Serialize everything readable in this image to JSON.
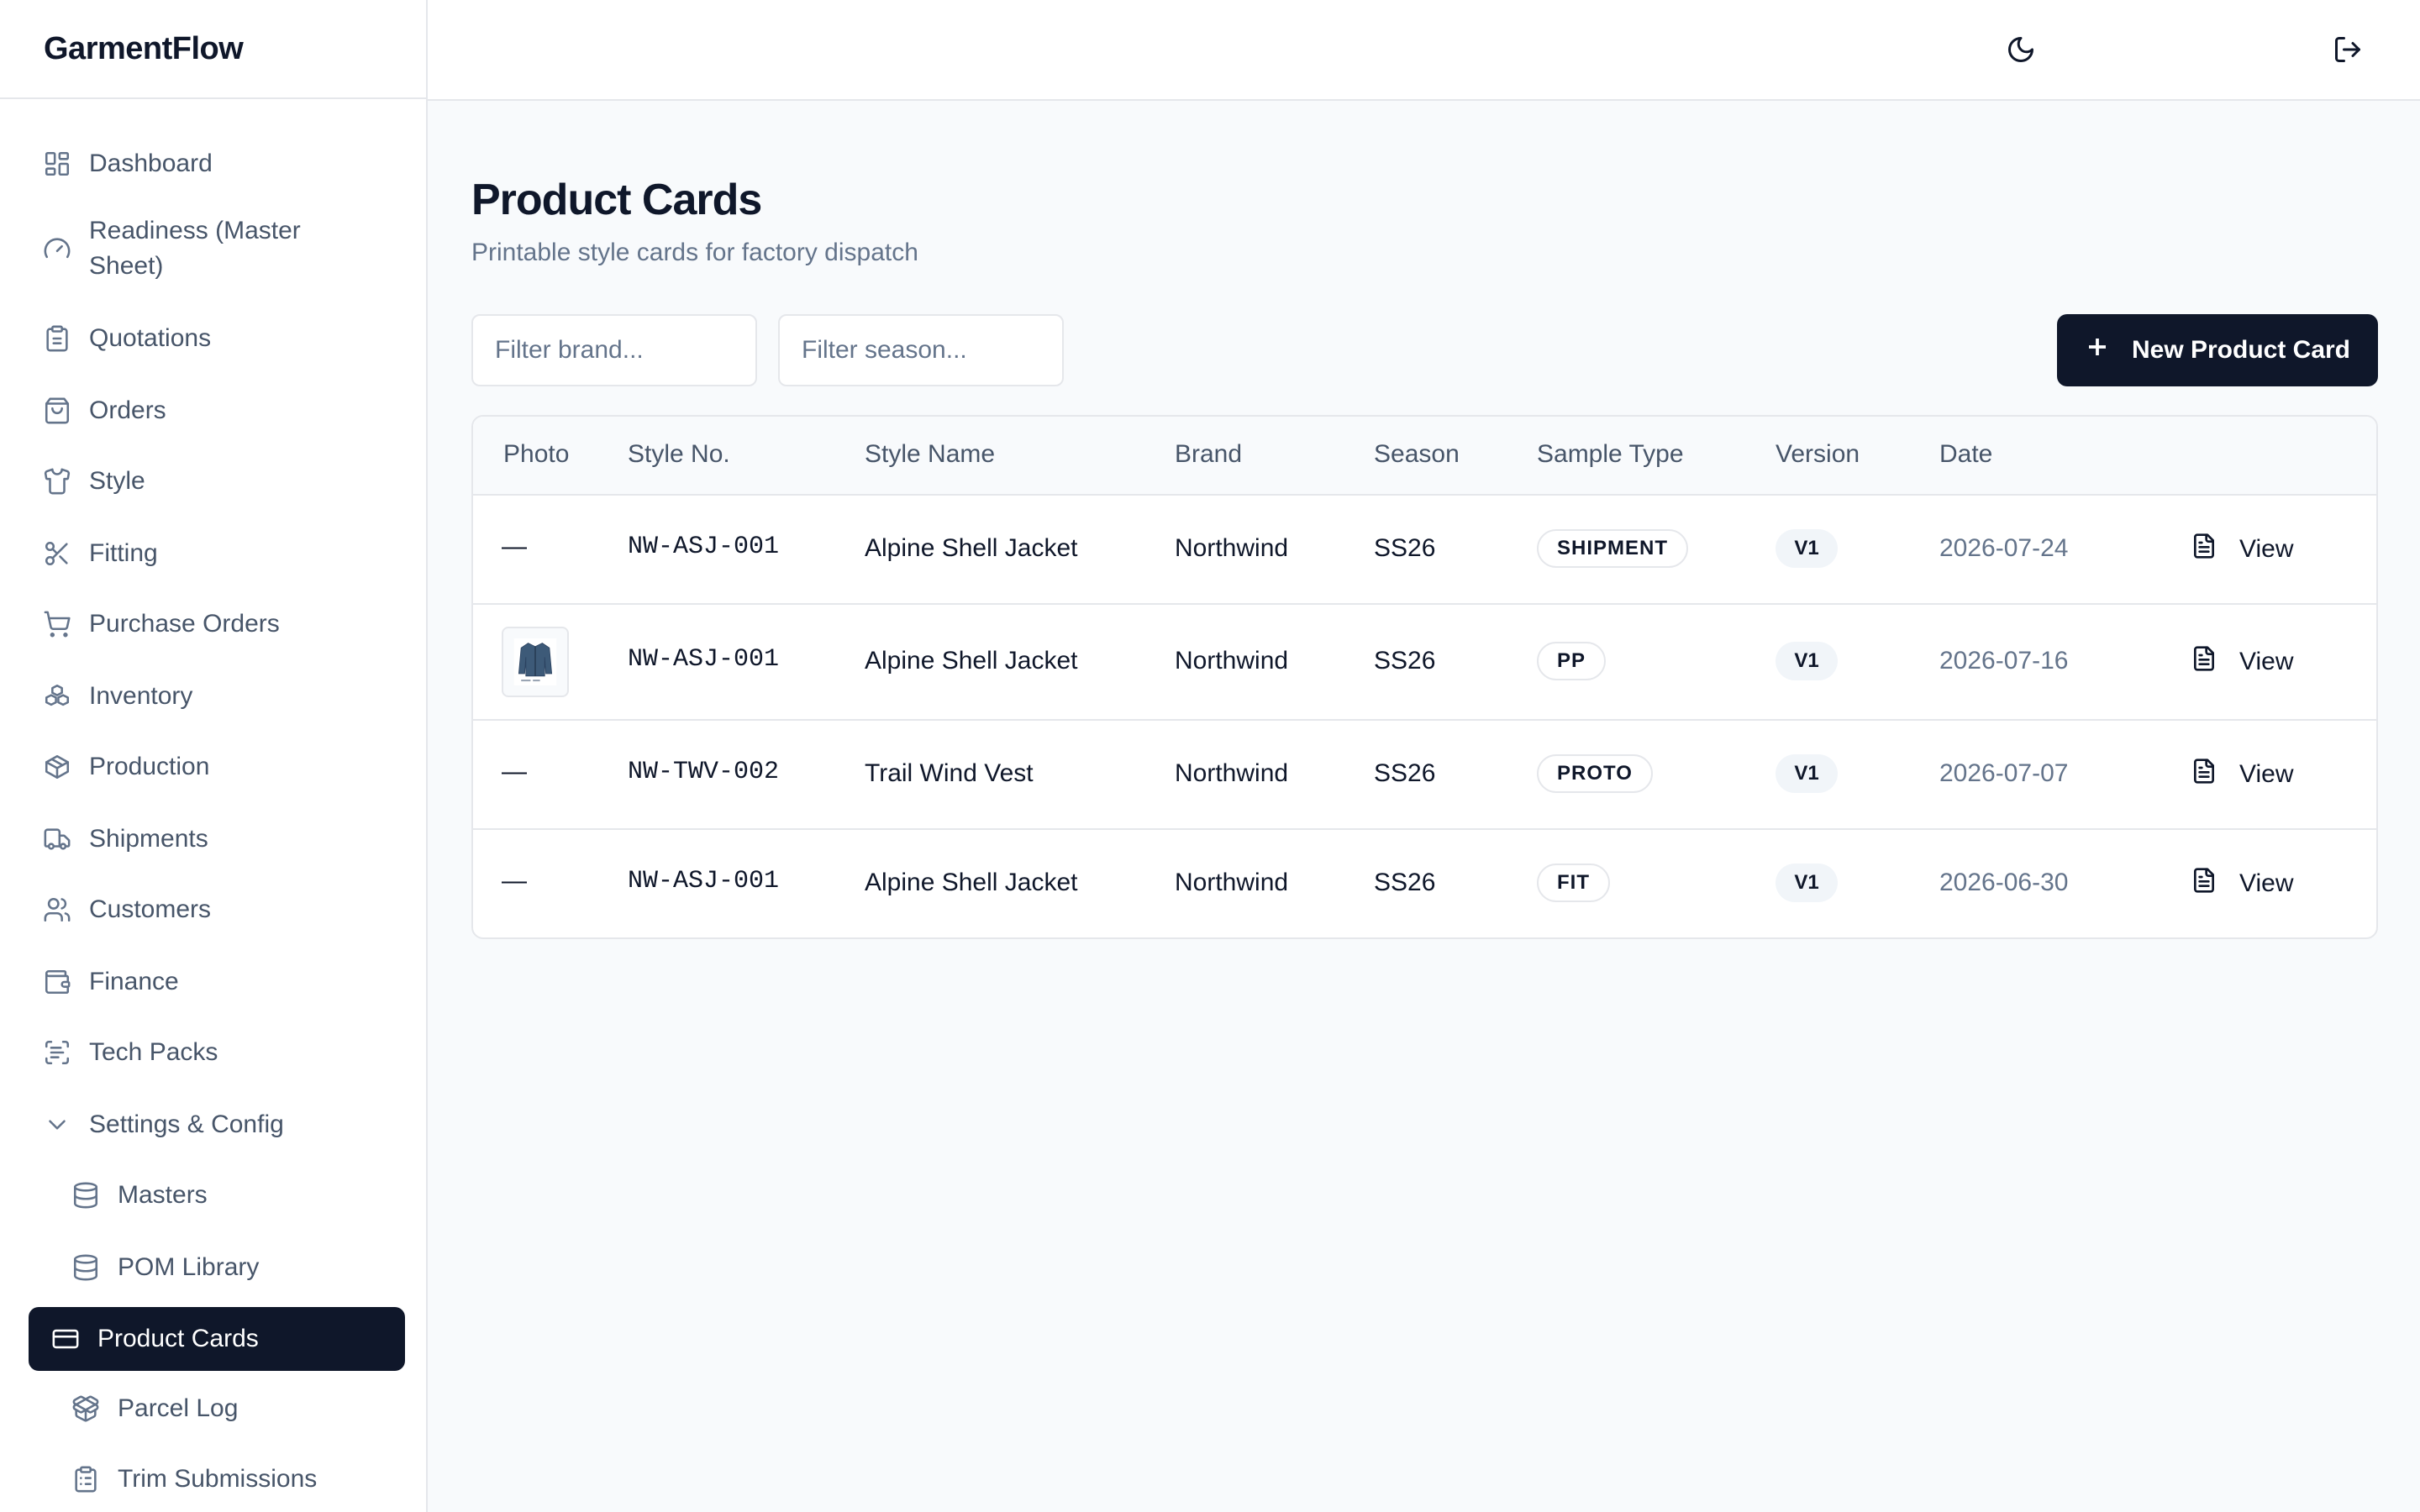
{
  "app": {
    "name": "GarmentFlow"
  },
  "sidebar": {
    "items": [
      {
        "label": "Dashboard",
        "icon": "dashboard-icon"
      },
      {
        "label": "Readiness (Master Sheet)",
        "icon": "gauge-icon"
      },
      {
        "label": "Quotations",
        "icon": "clipboard-icon"
      },
      {
        "label": "Orders",
        "icon": "shopping-bag-icon"
      },
      {
        "label": "Style",
        "icon": "shirt-icon"
      },
      {
        "label": "Fitting",
        "icon": "scissors-icon"
      },
      {
        "label": "Purchase Orders",
        "icon": "cart-icon"
      },
      {
        "label": "Inventory",
        "icon": "boxes-icon"
      },
      {
        "label": "Production",
        "icon": "package-icon"
      },
      {
        "label": "Shipments",
        "icon": "truck-icon"
      },
      {
        "label": "Customers",
        "icon": "users-icon"
      },
      {
        "label": "Finance",
        "icon": "wallet-icon"
      },
      {
        "label": "Tech Packs",
        "icon": "scan-text-icon"
      },
      {
        "label": "Settings & Config",
        "icon": "chevron-down-icon"
      },
      {
        "label": "Masters",
        "icon": "database-icon"
      },
      {
        "label": "POM Library",
        "icon": "database-icon"
      },
      {
        "label": "Product Cards",
        "icon": "card-icon",
        "active": true
      },
      {
        "label": "Parcel Log",
        "icon": "package-open-icon"
      },
      {
        "label": "Trim Submissions",
        "icon": "clipboard-list-icon"
      }
    ]
  },
  "topbar": {
    "theme_icon": "moon-icon",
    "logout_icon": "logout-icon"
  },
  "main": {
    "title": "Product Cards",
    "subtitle": "Printable style cards for factory dispatch",
    "filters": {
      "brand_placeholder": "Filter brand...",
      "season_placeholder": "Filter season..."
    },
    "new_button": "New Product Card"
  },
  "table": {
    "headers": [
      "Photo",
      "Style No.",
      "Style Name",
      "Brand",
      "Season",
      "Sample Type",
      "Version",
      "Date"
    ],
    "rows": [
      {
        "photo": "—",
        "style_no": "NW-ASJ-001",
        "style_name": "Alpine Shell Jacket",
        "brand": "Northwind",
        "season": "SS26",
        "sample_type": "SHIPMENT",
        "version": "V1",
        "date": "2026-07-24",
        "action": "View"
      },
      {
        "photo": "",
        "style_no": "NW-ASJ-001",
        "style_name": "Alpine Shell Jacket",
        "brand": "Northwind",
        "season": "SS26",
        "sample_type": "PP",
        "version": "V1",
        "date": "2026-07-16",
        "action": "View"
      },
      {
        "photo": "—",
        "style_no": "NW-TWV-002",
        "style_name": "Trail Wind Vest",
        "brand": "Northwind",
        "season": "SS26",
        "sample_type": "PROTO",
        "version": "V1",
        "date": "2026-07-07",
        "action": "View"
      },
      {
        "photo": "—",
        "style_no": "NW-ASJ-001",
        "style_name": "Alpine Shell Jacket",
        "brand": "Northwind",
        "season": "SS26",
        "sample_type": "FIT",
        "version": "V1",
        "date": "2026-06-30",
        "action": "View"
      }
    ]
  }
}
